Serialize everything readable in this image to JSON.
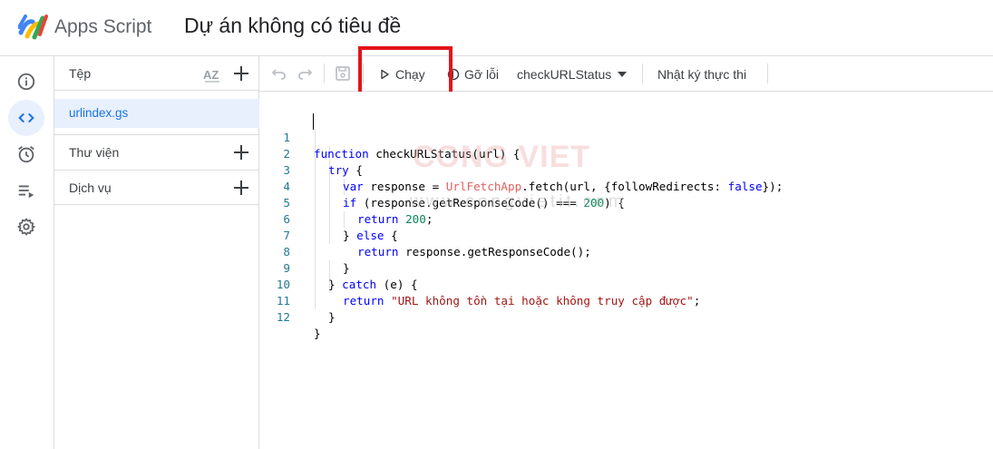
{
  "header": {
    "app_name": "Apps Script",
    "project_title": "Dự án không có tiêu đề"
  },
  "rail": {
    "items": [
      {
        "name": "overview",
        "icon": "info-icon"
      },
      {
        "name": "editor",
        "icon": "code-icon",
        "active": true
      },
      {
        "name": "triggers",
        "icon": "alarm-clock-icon"
      },
      {
        "name": "executions",
        "icon": "run-list-icon"
      },
      {
        "name": "settings",
        "icon": "gear-icon"
      }
    ]
  },
  "files": {
    "title": "Tệp",
    "sort_label": "AZ",
    "items": [
      {
        "name": "urlindex.gs"
      }
    ],
    "sections": [
      {
        "label": "Thư viện"
      },
      {
        "label": "Dịch vụ"
      }
    ]
  },
  "toolbar": {
    "run_label": "Chạy",
    "debug_label": "Gỡ lỗi",
    "function_selected": "checkURLStatus",
    "log_label": "Nhật ký thực thi"
  },
  "editor": {
    "lines": [
      {
        "n": "1"
      },
      {
        "n": "2"
      },
      {
        "n": "3"
      },
      {
        "n": "4"
      },
      {
        "n": "5"
      },
      {
        "n": "6"
      },
      {
        "n": "7"
      },
      {
        "n": "8"
      },
      {
        "n": "9"
      },
      {
        "n": "10"
      },
      {
        "n": "11"
      },
      {
        "n": "12"
      }
    ],
    "code": {
      "l1_kw": "function",
      "l1_rest": " checkURLStatus(url) {",
      "l2_kw": "try",
      "l2_rest": " {",
      "l3_kw": "var",
      "l3_a": " response = ",
      "l3_cls": "UrlFetchApp",
      "l3_b": ".fetch(url, {followRedirects: ",
      "l3_kw2": "false",
      "l3_c": "});",
      "l4_kw": "if",
      "l4_a": " (response.getResponseCode() === ",
      "l4_num": "200",
      "l4_b": ") {",
      "l5_kw": "return",
      "l5_num": "200",
      "l5_b": ";",
      "l6_a": "} ",
      "l6_kw": "else",
      "l6_b": " {",
      "l7_kw": "return",
      "l7_rest": " response.getResponseCode();",
      "l8": "}",
      "l9_a": "} ",
      "l9_kw": "catch",
      "l9_b": " (e) {",
      "l10_kw": "return",
      "l10_str": "\"URL không tồn tại hoặc không truy cập được\"",
      "l10_b": ";",
      "l11": "}",
      "l12": "}"
    }
  },
  "watermark": {
    "logo": "CONG VIET",
    "url": "www.congvietit.com"
  },
  "colors": {
    "accent": "#1a73e8",
    "highlight_box": "#e3141a",
    "active_bg": "#e8f0fe"
  }
}
